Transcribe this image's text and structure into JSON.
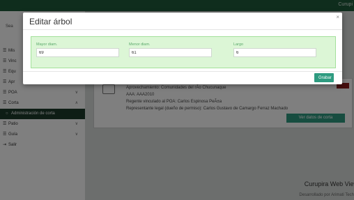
{
  "app": {
    "brand": "Curupi"
  },
  "sidebar": {
    "search_label": "Sea",
    "items": [
      {
        "label": "Mis",
        "icon": "list-icon",
        "chevron": "",
        "active": false
      },
      {
        "label": "Vinc",
        "icon": "list-icon",
        "chevron": "",
        "active": false
      },
      {
        "label": "Equ",
        "icon": "list-icon",
        "chevron": "",
        "active": false
      },
      {
        "label": "Apr",
        "icon": "list-icon",
        "chevron": "",
        "active": false
      },
      {
        "label": "POA",
        "icon": "list-icon",
        "chevron": "∨",
        "active": false
      },
      {
        "label": "Corta",
        "icon": "list-icon",
        "chevron": "∧",
        "active": false
      },
      {
        "label": "Administración de corta",
        "icon": "circle-icon",
        "chevron": "",
        "active": true
      },
      {
        "label": "Patio",
        "icon": "list-icon",
        "chevron": "∨",
        "active": false
      },
      {
        "label": "Guía",
        "icon": "list-icon",
        "chevron": "∨",
        "active": false
      },
      {
        "label": "Salir",
        "icon": "exit-icon",
        "chevron": "",
        "active": false
      }
    ]
  },
  "card": {
    "badge": "",
    "lines": [
      "Aprovechamiento: Comunidades del rÃo Chucunaque",
      "AAA: AAA2010",
      "Regente vinculado al POA: Carlos Espinosa PeÃ±a",
      "Representante legal (dueño de permiso): Carlos Gustavo de Camargo Ferraz Machado"
    ],
    "ver_button": "Ver datos de corta"
  },
  "footer": {
    "title": "Curupira Web View",
    "subtitle": "Desarrollado por Arimati Tech"
  },
  "modal": {
    "title": "Editar árbol",
    "close_symbol": "×",
    "fields": [
      {
        "label": "Mayor diam.",
        "value": "69"
      },
      {
        "label": "Menor diam.",
        "value": "61"
      },
      {
        "label": "Largo",
        "value": "6"
      }
    ],
    "submit_label": "Grabar"
  },
  "colors": {
    "topbar": "#1e5a3a",
    "accent_button": "#2e9b80",
    "form_panel_bg": "#dcf6d6",
    "form_panel_border": "#a3e09a",
    "sidebar_active": "#1d3a2b"
  }
}
